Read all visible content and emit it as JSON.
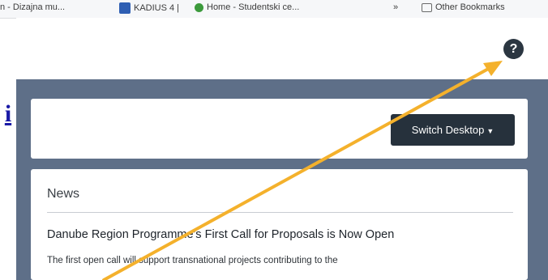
{
  "bookmarks": [
    {
      "label": "n - Dizajna mu...",
      "icon": "page-icon"
    },
    {
      "label": "KADIUS 4 |",
      "icon": "bookmark-page-icon",
      "color": "#2f5fb3"
    },
    {
      "label": "Home - Studentski ce...",
      "icon": "green-dot-icon",
      "color": "#3c9a3c"
    },
    {
      "label": "Other Bookmarks",
      "icon": "folder-icon"
    }
  ],
  "overflow_label": "»",
  "help_label": "?",
  "left_link": "i",
  "switch_desktop": {
    "label": "Switch Desktop"
  },
  "news": {
    "title": "News",
    "heading": "Danube Region Programme's First Call for Proposals is Now Open",
    "body": "The first open call will support transnational projects contributing to the"
  },
  "annotation_color": "#f4b12c"
}
